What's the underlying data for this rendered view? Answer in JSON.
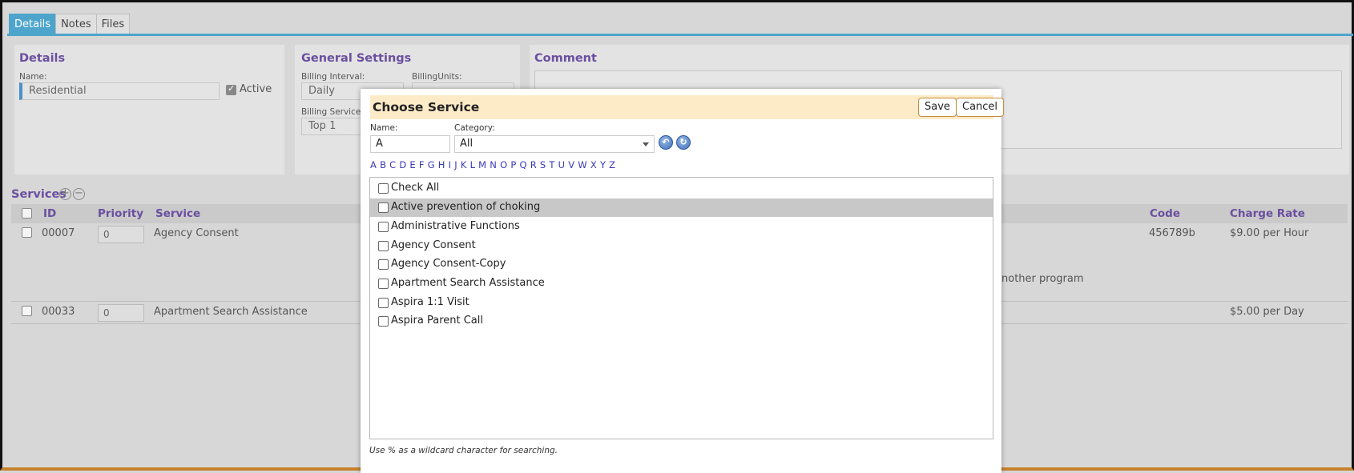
{
  "tabs": [
    "Details",
    "Notes",
    "Files"
  ],
  "details": {
    "title": "Details",
    "name_label": "Name:",
    "name_value": "Residential",
    "active_label": "Active"
  },
  "general": {
    "title": "General Settings",
    "billing_interval_label": "Billing Interval:",
    "billing_interval_value": "Daily",
    "billing_units_label": "BillingUnits:",
    "billing_service_label": "Billing Service S",
    "billing_service_value": "Top 1"
  },
  "comment": {
    "title": "Comment"
  },
  "services": {
    "title": "Services",
    "add_symbol": "+",
    "remove_symbol": "−",
    "columns": {
      "id": "ID",
      "priority": "Priority",
      "service": "Service",
      "code": "Code",
      "charge_rate": "Charge Rate"
    },
    "rows": [
      {
        "id": "00007",
        "priority": "0",
        "service": "Agency Consent",
        "code": "456789b",
        "charge_rate": "$9.00 per Hour",
        "note": "nother program"
      },
      {
        "id": "00033",
        "priority": "0",
        "service": "Apartment Search Assistance",
        "code": "",
        "charge_rate": "$5.00 per Day",
        "note": ""
      }
    ]
  },
  "dialog": {
    "title": "Choose Service",
    "save_label": "Save",
    "cancel_label": "Cancel",
    "name_label": "Name:",
    "name_value": "A",
    "category_label": "Category:",
    "category_value": "All",
    "alphabet": [
      "A",
      "B",
      "C",
      "D",
      "E",
      "F",
      "G",
      "H",
      "I",
      "J",
      "K",
      "L",
      "M",
      "N",
      "O",
      "P",
      "Q",
      "R",
      "S",
      "T",
      "U",
      "V",
      "W",
      "X",
      "Y",
      "Z"
    ],
    "check_all_label": "Check All",
    "items": [
      "Active prevention of choking",
      "Administrative Functions",
      "Agency Consent",
      "Agency Consent-Copy",
      "Apartment Search Assistance",
      "Aspira 1:1 Visit",
      "Aspira Parent Call"
    ],
    "highlighted_item": "Active prevention of choking",
    "hint": "Use % as a wildcard character for searching."
  }
}
